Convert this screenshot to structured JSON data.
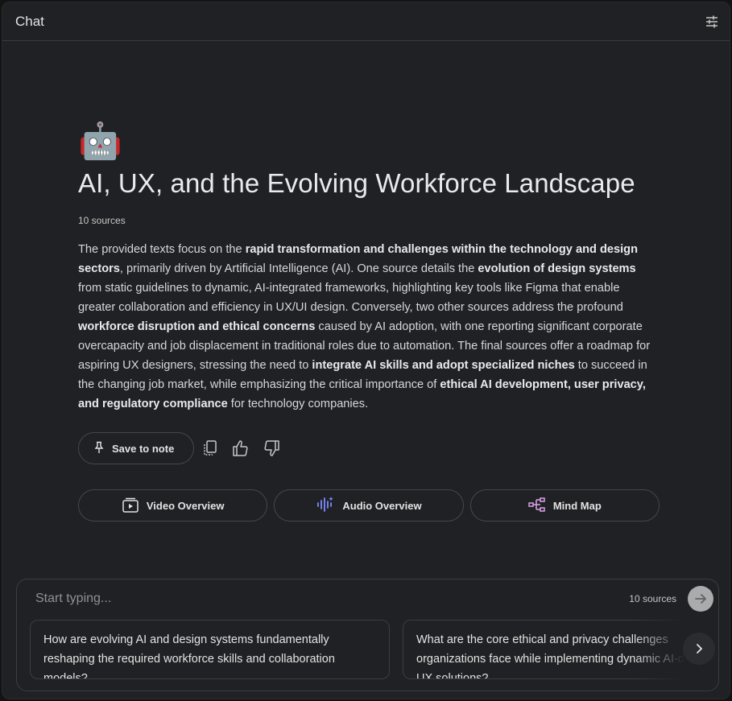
{
  "header": {
    "title": "Chat",
    "settings_icon": "tune-icon"
  },
  "notebook": {
    "emoji": "🤖",
    "title": "AI, UX, and the Evolving Workforce Landscape",
    "sources": "10 sources",
    "summary": [
      {
        "t": "The provided texts focus on the ",
        "b": false
      },
      {
        "t": "rapid transformation and challenges within the technology and design sectors",
        "b": true
      },
      {
        "t": ", primarily driven by Artificial Intelligence (AI). One source details the ",
        "b": false
      },
      {
        "t": "evolution of design systems",
        "b": true
      },
      {
        "t": " from static guidelines to dynamic, AI-integrated frameworks, highlighting key tools like Figma that enable greater collaboration and efficiency in UX/UI design. Conversely, two other sources address the profound ",
        "b": false
      },
      {
        "t": "workforce disruption and ethical concerns",
        "b": true
      },
      {
        "t": " caused by AI adoption, with one reporting significant corporate overcapacity and job displacement in traditional roles due to automation. The final sources offer a roadmap for aspiring UX designers, stressing the need to ",
        "b": false
      },
      {
        "t": "integrate AI skills and adopt specialized niches",
        "b": true
      },
      {
        "t": " to succeed in the changing job market, while emphasizing the critical importance of ",
        "b": false
      },
      {
        "t": "ethical AI development, user privacy, and regulatory compliance",
        "b": true
      },
      {
        "t": " for technology companies.",
        "b": false
      }
    ]
  },
  "actions": {
    "save_label": "Save to note",
    "save_icon": "pin-icon",
    "copy_icon": "copy-icon",
    "like_icon": "thumbs-up-icon",
    "dislike_icon": "thumbs-down-icon"
  },
  "overviews": {
    "video": "Video Overview",
    "audio": "Audio Overview",
    "mindmap": "Mind Map"
  },
  "composer": {
    "placeholder": "Start typing...",
    "sources": "10 sources",
    "suggestions": [
      "How are evolving AI and design systems fundamentally reshaping the required workforce skills and collaboration models?",
      "What are the core ethical and privacy challenges organizations face while implementing dynamic AI-driven UX solutions?"
    ]
  },
  "colors": {
    "background": "#202124",
    "audio_accent": "#7b8cff",
    "mindmap_accent": "#d9a3e8"
  }
}
